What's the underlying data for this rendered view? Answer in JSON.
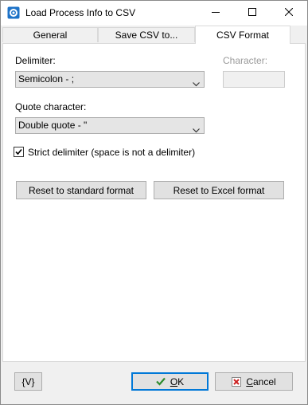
{
  "window": {
    "title": "Load Process Info to CSV",
    "icons": {
      "app": "app-gear-icon",
      "minimize": "minimize-icon",
      "maximize": "maximize-icon",
      "close": "close-icon"
    }
  },
  "tabs": [
    {
      "label": "General",
      "active": false
    },
    {
      "label": "Save CSV to...",
      "active": false
    },
    {
      "label": "CSV Format",
      "active": true
    }
  ],
  "csv_format": {
    "delimiter_label": "Delimiter:",
    "delimiter_value": "Semicolon - ;",
    "character_label": "Character:",
    "character_value": "",
    "quote_label": "Quote character:",
    "quote_value": "Double quote - \"",
    "strict_label": "Strict delimiter (space is not a delimiter)",
    "strict_checked": true,
    "reset_standard_label": "Reset to standard format",
    "reset_excel_label": "Reset to Excel format"
  },
  "footer": {
    "variables_label": "{V}",
    "ok_label": "OK",
    "ok_accel": "O",
    "ok_rest": "K",
    "cancel_label": "Cancel",
    "cancel_accel": "C",
    "cancel_rest": "ancel"
  },
  "colors": {
    "accent": "#0078d7",
    "ok_check": "#2e8b2e",
    "cancel_x": "#cc2222"
  }
}
